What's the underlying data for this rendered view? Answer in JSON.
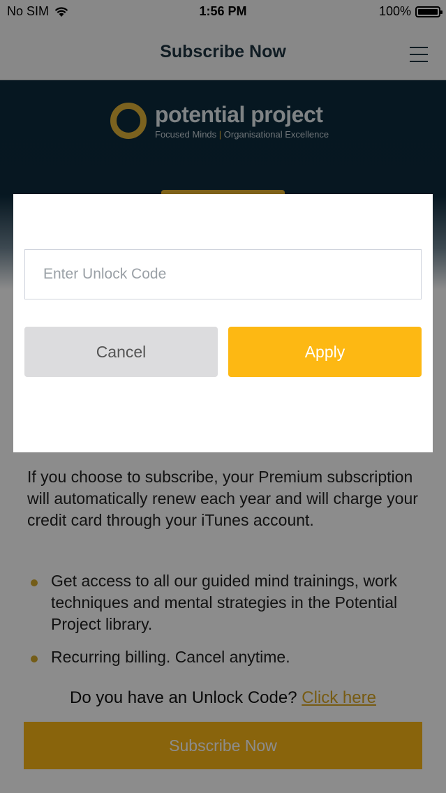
{
  "status_bar": {
    "carrier": "No SIM",
    "time": "1:56 PM",
    "battery": "100%"
  },
  "nav": {
    "title": "Subscribe Now",
    "menu_icon": "hamburger-menu-icon"
  },
  "logo": {
    "name": "potential project",
    "tagline_left": "Focused Minds",
    "tagline_sep": "|",
    "tagline_right": "Organisational Excellence"
  },
  "content": {
    "intro": "If you choose to subscribe, your Premium subscription will automatically renew each year and will charge your credit card through your iTunes account.",
    "bullets": [
      "Get access to all our guided mind trainings, work techniques and mental strategies in the Potential Project library.",
      "Recurring billing. Cancel anytime."
    ],
    "unlock_prompt": "Do you have an Unlock Code?",
    "unlock_link": "Click here",
    "subscribe_button": "Subscribe Now"
  },
  "modal": {
    "input_placeholder": "Enter Unlock Code",
    "input_value": "",
    "cancel_label": "Cancel",
    "apply_label": "Apply"
  },
  "colors": {
    "brand_yellow": "#fdb813",
    "nav_text": "#1e3340",
    "hero_dark": "#0c2a3c"
  }
}
